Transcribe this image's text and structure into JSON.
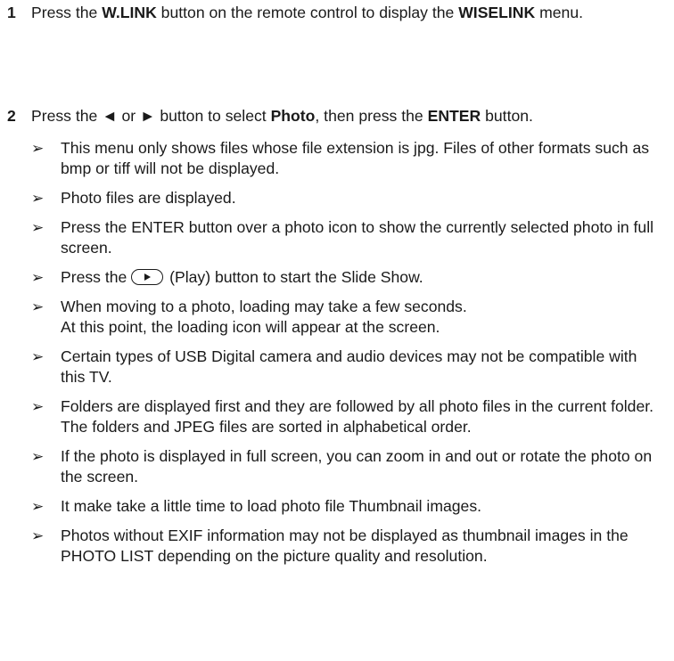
{
  "step1": {
    "number": "1",
    "pre": "Press the ",
    "button": "W.LINK",
    "mid": " button on the remote control to display the ",
    "menu": "WISELINK",
    "post": " menu."
  },
  "step2": {
    "number": "2",
    "pre": "Press the ◄ or ► button to select ",
    "item": "Photo",
    "mid": ", then press the ",
    "button": "ENTER",
    "post": " button."
  },
  "note_marker": "➢",
  "notes": [
    "This menu only shows files whose file extension is jpg. Files of other formats such as bmp or tiff will not be displayed.",
    "Photo files are displayed.",
    "Press the ENTER button over a photo icon to show the currently selected photo in full screen.",
    "(Play) button to start the Slide Show.",
    "When moving to a photo, loading may take a few seconds.",
    "At this point, the loading icon will appear at the screen.",
    "Certain types of USB Digital camera and audio devices may not be compatible with this TV.",
    "Folders are displayed first and they are followed by all photo files in the current folder. The folders and JPEG files are sorted in alphabetical order.",
    "If the photo is displayed in full screen, you can zoom in and out or rotate the photo on the screen.",
    "It make take a little time to load photo file Thumbnail images.",
    "Photos without EXIF information may not be displayed as thumbnail images in the PHOTO LIST depending on the picture quality and resolution."
  ],
  "note4_pre": "Press the ",
  "play_icon": "play-button-icon"
}
